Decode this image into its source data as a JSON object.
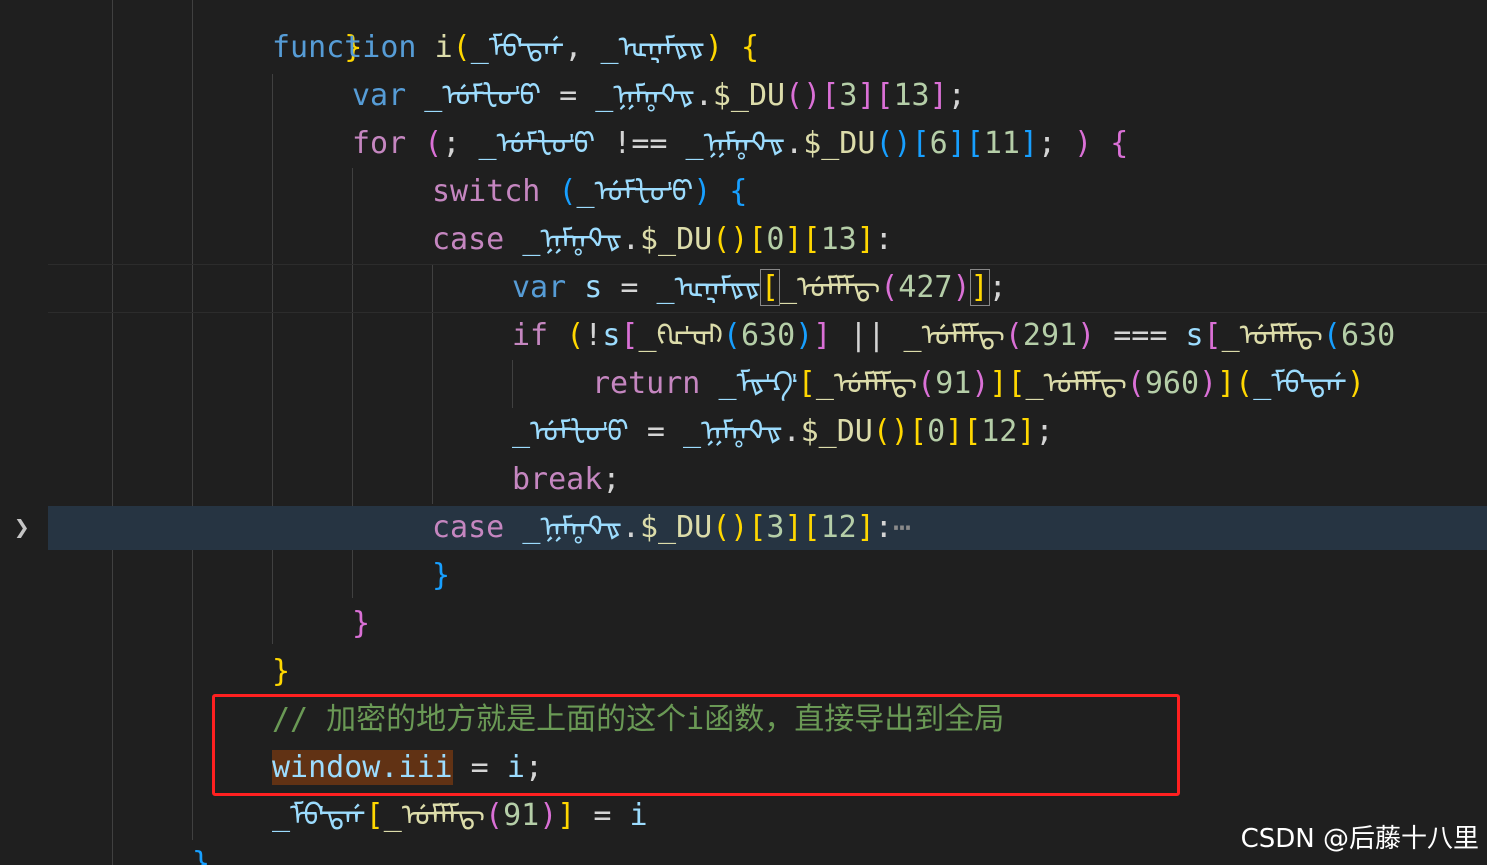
{
  "code": {
    "l0": "}",
    "l1_kw": "function",
    "l1_name": "i",
    "l1_p1": "_ᡏᡋᡃᡖᡤ",
    "l1_p2": "_ᡅᡎᡏᡑᡑ",
    "l2_kw": "var",
    "l2_v": "_ᡠᡏᡶᡉᡃᡦ",
    "l2_obj": "_ᡍᡏᡎᡐᡑ",
    "l2_fn": "$_DU",
    "l2_i1": "3",
    "l2_i2": "13",
    "l3_kw": "for",
    "l3_v": "_ᡠᡏᡶᡉᡃᡦ",
    "l3_op": "!==",
    "l3_obj": "_ᡍᡏᡎᡐᡑ",
    "l3_fn": "$_DU",
    "l3_i1": "6",
    "l3_i2": "11",
    "l4_kw": "switch",
    "l4_v": "_ᡠᡏᡶᡉᡃᡦ",
    "l5_kw": "case",
    "l5_obj": "_ᡍᡏᡎᡐᡑ",
    "l5_fn": "$_DU",
    "l5_i1": "0",
    "l5_i2": "13",
    "l6_kw": "var",
    "l6_v": "s",
    "l6_obj": "_ᡅᡎᡏᡑᡑ",
    "l6_fn": "_ᡠᡏᡏᡏᡖ",
    "l6_n": "427",
    "l7_kw": "if",
    "l7_v": "s",
    "l7_fn": "_ᡍᡅᡃᡆᡅ",
    "l7_n": "630",
    "l7_op": "||",
    "l7_fn2": "_ᡠᡏᡏᡏᡖ",
    "l7_n2": "291",
    "l7_op2": "===",
    "l7_v2": "s",
    "l7_fn3": "_ᡠᡏᡏᡏᡖ",
    "l7_n3": "630",
    "l8_kw": "return",
    "l8_obj": "_ᡏᡑᡃᡗᡃ",
    "l8_fn": "_ᡠᡏᡏᡏᡖ",
    "l8_n": "91",
    "l8_fn2": "_ᡠᡏᡏᡏᡖ",
    "l8_n2": "960",
    "l8_v": "_ᡏᡋᡃᡖᡤ",
    "l9_v": "_ᡠᡏᡶᡉᡃᡦ",
    "l9_obj": "_ᡍᡏᡎᡐᡑ",
    "l9_fn": "$_DU",
    "l9_i1": "0",
    "l9_i2": "12",
    "l10_kw": "break",
    "l11_kw": "case",
    "l11_obj": "_ᡍᡏᡎᡐᡑ",
    "l11_fn": "$_DU",
    "l11_i1": "3",
    "l11_i2": "12",
    "l11_fold": "⋯",
    "l12": "}",
    "l13": "}",
    "l14": "}",
    "l15_comment": "// 加密的地方就是上面的这个i函数，直接导出到全局",
    "l16_win": "window.iii",
    "l16_rest": "i",
    "l17_obj": "_ᡏᡋᡃᡖᡤ",
    "l17_fn": "_ᡠᡏᡏᡏᡖ",
    "l17_n": "91",
    "l17_v": "i"
  },
  "fold_icon": "chevron-right-icon",
  "watermark": "CSDN @后藤十八里",
  "colors": {
    "background": "#1f1f1f",
    "keyword": "#569cd6",
    "control": "#c586c0",
    "function": "#dcdcaa",
    "variable": "#9cdcfe",
    "number": "#b5cea8",
    "comment": "#6a9955",
    "annotation_box": "#ff2020"
  }
}
